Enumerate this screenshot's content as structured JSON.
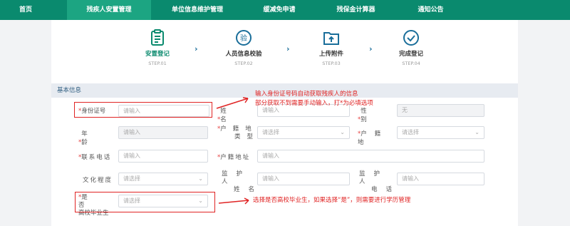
{
  "nav": {
    "items": [
      "首页",
      "残疾人安置管理",
      "单位信息维护管理",
      "缓减免申请",
      "残保金计算器",
      "通知公告"
    ]
  },
  "steps": [
    {
      "title": "安置登记",
      "sub": "STEP.01"
    },
    {
      "title": "人员信息校验",
      "sub": "STEP.02",
      "icon_text": "验"
    },
    {
      "title": "上传附件",
      "sub": "STEP.03"
    },
    {
      "title": "完成登记",
      "sub": "STEP.04"
    }
  ],
  "arrow": "›",
  "section": {
    "title": "基本信息"
  },
  "form": {
    "req": "*",
    "id_label": "身份证号",
    "name_label": "姓名",
    "gender_label": "性别",
    "age_label": "年龄",
    "hukou_type_label_1": "户籍地",
    "hukou_type_label_2": "类型",
    "hukou_label": "户籍地",
    "phone_label": "联系电话",
    "hukou_addr_label": "户籍地址",
    "edu_label": "文化程度",
    "guardian_name_label_1": "监护人",
    "guardian_name_label_2": "姓名",
    "guardian_phone_label_1": "监护人",
    "guardian_phone_label_2": "电话",
    "grad_label_1": "是否",
    "grad_label_2": "高校毕业生",
    "placeholder_input": "请输入",
    "placeholder_select": "请选择",
    "gender_value": "无"
  },
  "annotations": {
    "note1_line1": "输入身份证号码自动获取残疾人的信息",
    "note1_line2": "部分获取不到需要手动输入，打*为必填选项",
    "note2": "选择是否高校毕业生，如果选择“是”，则需要进行学历管理"
  },
  "colors": {
    "nav": "#0a8a6e",
    "nav_active": "#1ca582",
    "accent": "#0a8a6e",
    "annotation": "#e02424"
  }
}
